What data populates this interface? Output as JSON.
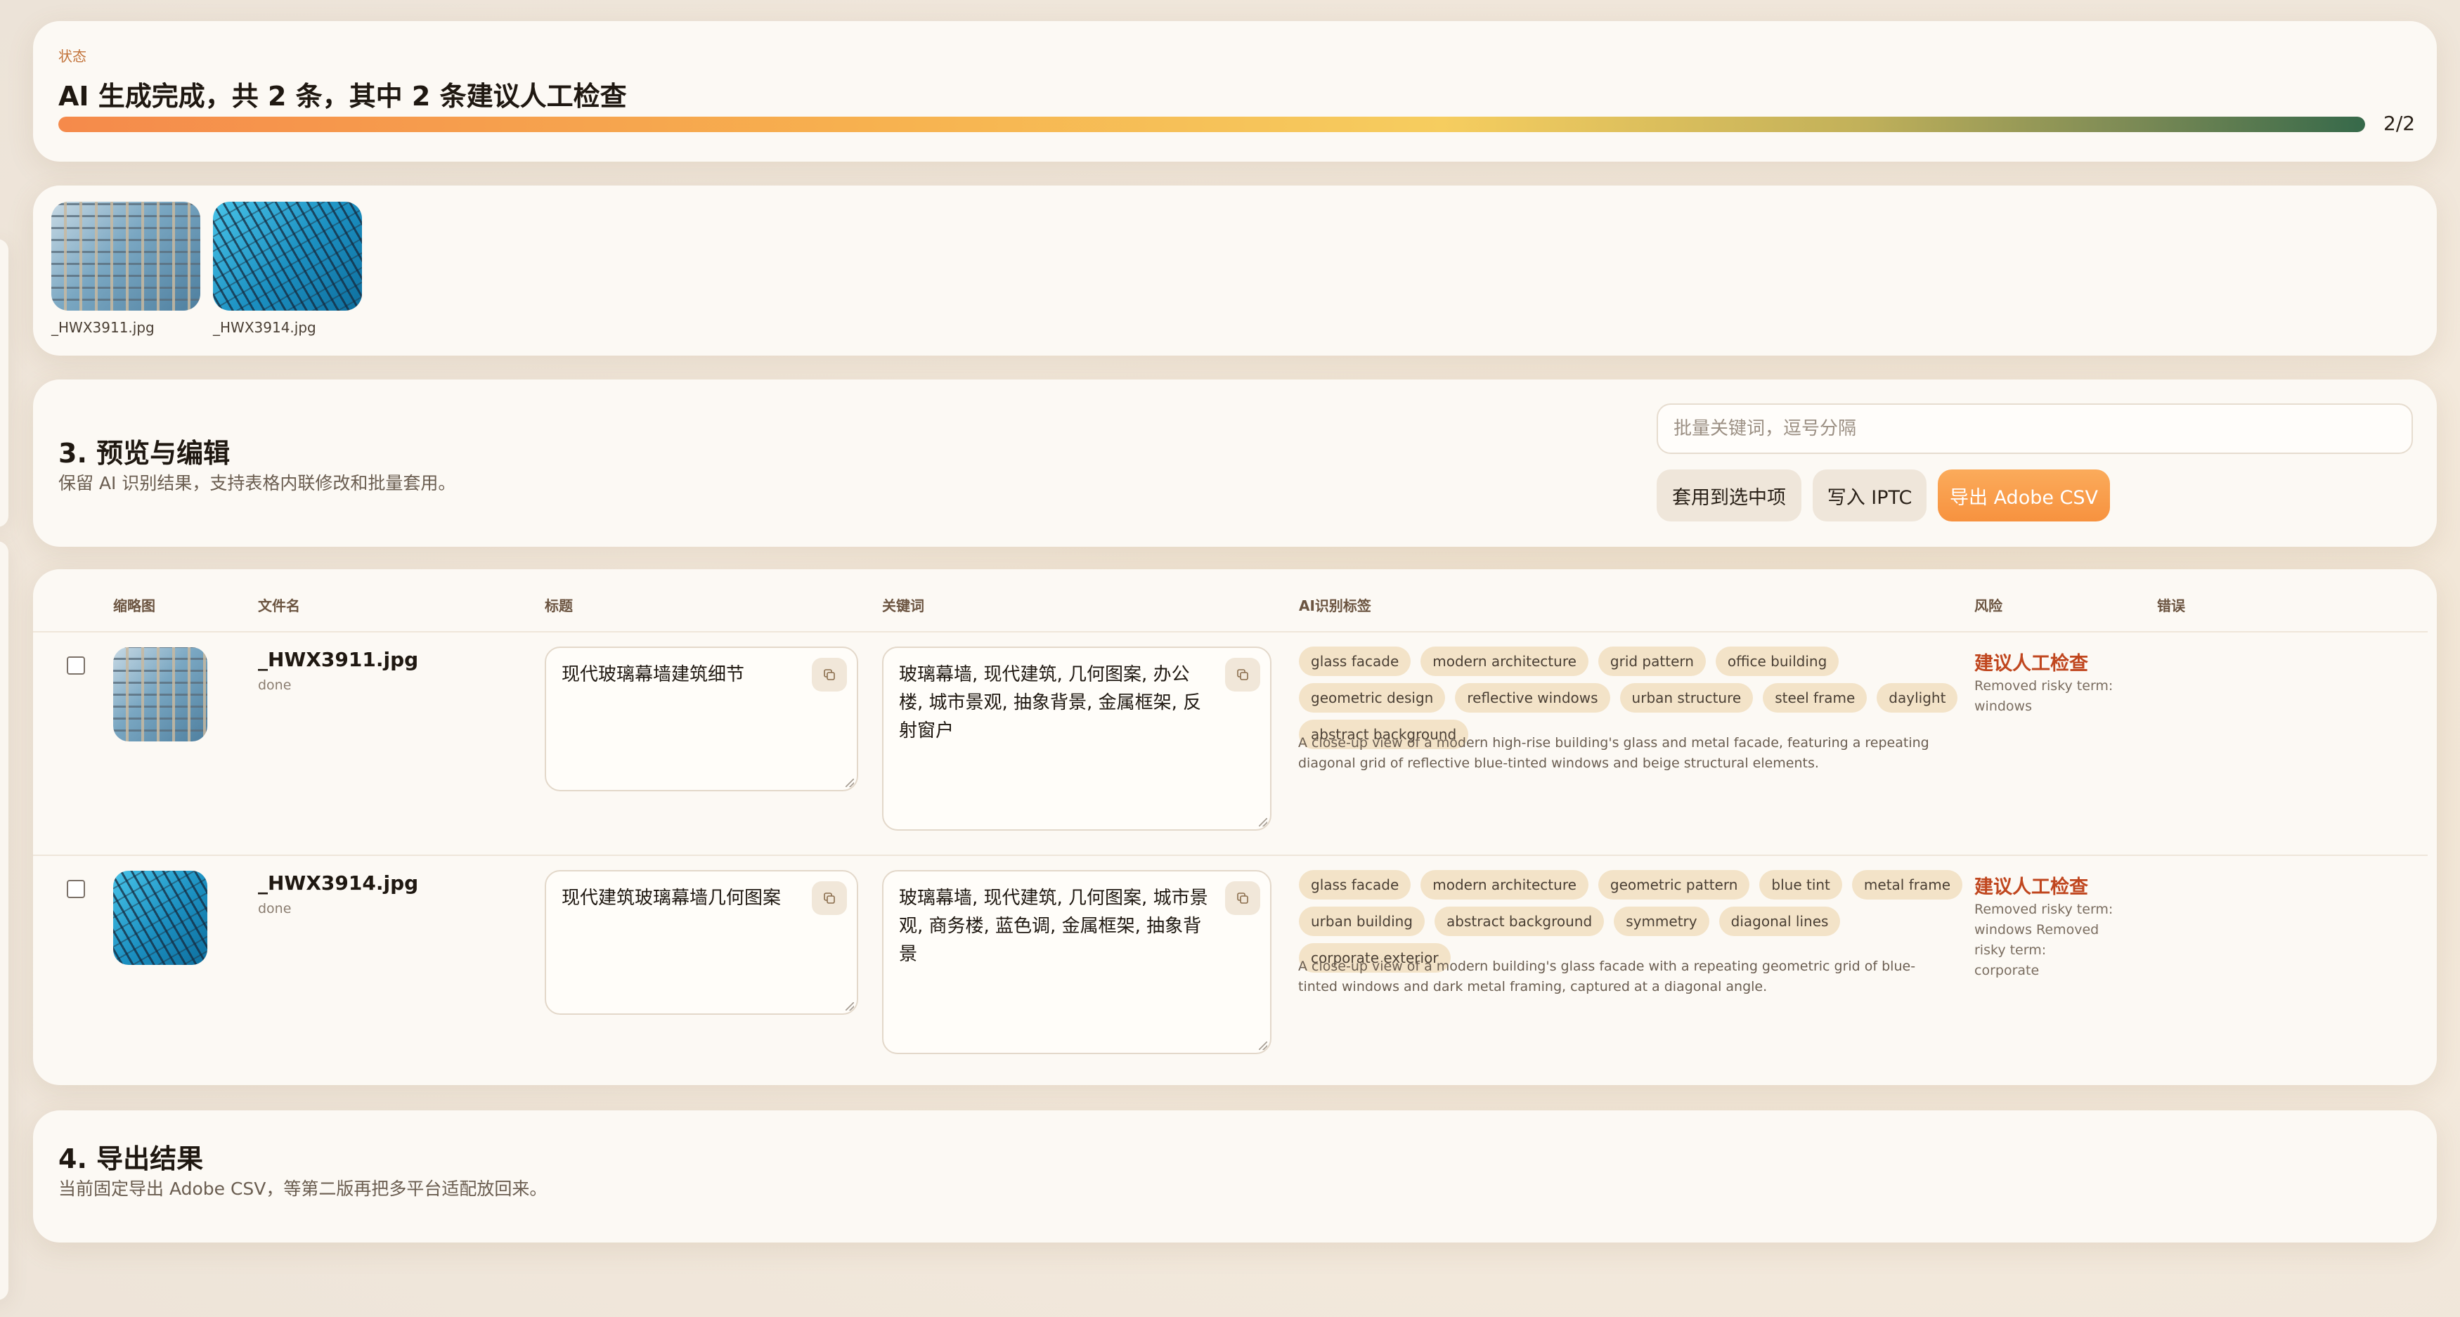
{
  "status": {
    "label": "状态",
    "message": "AI 生成完成，共 2 条，其中 2 条建议人工检查",
    "progress_fraction": 1.0,
    "progress_text": "2/2"
  },
  "thumbnails": [
    {
      "filename": "_HWX3911.jpg"
    },
    {
      "filename": "_HWX3914.jpg"
    }
  ],
  "preview": {
    "title": "3. 预览与编辑",
    "subtitle": "保留 AI 识别结果，支持表格内联修改和批量套用。",
    "batch_placeholder": "批量关键词，逗号分隔",
    "apply_button": "套用到选中项",
    "iptc_button": "写入 IPTC",
    "export_button": "导出 Adobe CSV"
  },
  "table": {
    "headers": {
      "thumbnail": "缩略图",
      "filename": "文件名",
      "title": "标题",
      "keywords": "关键词",
      "ai_tags": "AI识别标签",
      "risk": "风险",
      "error": "错误"
    },
    "rows": [
      {
        "filename": "_HWX3911.jpg",
        "status": "done",
        "title": "现代玻璃幕墙建筑细节",
        "keywords": "玻璃幕墙, 现代建筑, 几何图案, 办公楼, 城市景观, 抽象背景, 金属框架, 反射窗户",
        "tags": [
          "glass facade",
          "modern architecture",
          "grid pattern",
          "office building",
          "geometric design",
          "reflective windows",
          "urban structure",
          "steel frame",
          "daylight",
          "abstract background"
        ],
        "description": "A close-up view of a modern high-rise building's glass and metal facade, featuring a repeating diagonal grid of reflective blue-tinted windows and beige structural elements.",
        "risk": "建议人工检查",
        "risk_notes": "Removed risky term: windows",
        "error": ""
      },
      {
        "filename": "_HWX3914.jpg",
        "status": "done",
        "title": "现代建筑玻璃幕墙几何图案",
        "keywords": "玻璃幕墙, 现代建筑, 几何图案, 城市景观, 商务楼, 蓝色调, 金属框架, 抽象背景",
        "tags": [
          "glass facade",
          "modern architecture",
          "geometric pattern",
          "blue tint",
          "metal frame",
          "urban building",
          "abstract background",
          "symmetry",
          "diagonal lines",
          "corporate exterior"
        ],
        "description": "A close-up view of a modern building's glass facade with a repeating geometric grid of blue-tinted windows and dark metal framing, captured at a diagonal angle.",
        "risk": "建议人工检查",
        "risk_notes": "Removed risky term: windows Removed risky term: corporate",
        "error": ""
      }
    ]
  },
  "export": {
    "title": "4. 导出结果",
    "subtitle": "当前固定导出 Adobe CSV，等第二版再把多平台适配放回来。"
  },
  "colors": {
    "accent": "#f7923f",
    "risk": "#c0461e",
    "tag_bg": "#f3e3c8",
    "card_bg": "#fcf9f4"
  },
  "icons": {
    "copy": "copy-icon"
  }
}
